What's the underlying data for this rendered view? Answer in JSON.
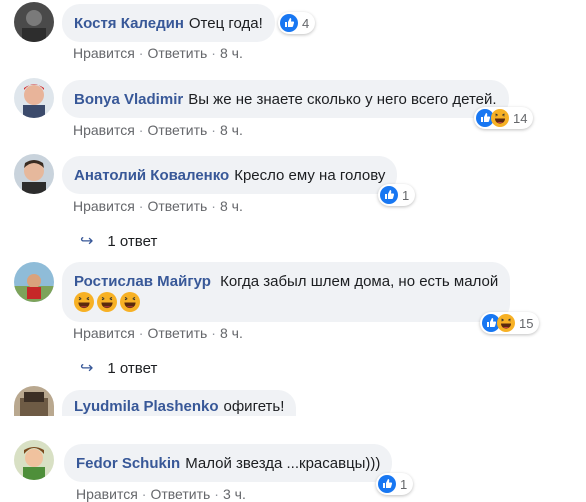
{
  "comments": [
    {
      "author": "Костя Каледин",
      "text": "Отец года!",
      "actions": {
        "like": "Нравится",
        "reply": "Ответить",
        "time": "8 ч."
      },
      "reactions": {
        "types": [
          "like"
        ],
        "count": "4"
      }
    },
    {
      "author": "Bonya Vladimir",
      "text": "Вы же не знаете сколько у него всего детей.",
      "actions": {
        "like": "Нравится",
        "reply": "Ответить",
        "time": "8 ч."
      },
      "reactions": {
        "types": [
          "like",
          "haha"
        ],
        "count": "14"
      }
    },
    {
      "author": "Анатолий Коваленко",
      "text": "Кресло ему на голову",
      "actions": {
        "like": "Нравится",
        "reply": "Ответить",
        "time": "8 ч."
      },
      "reactions": {
        "types": [
          "like"
        ],
        "count": "1"
      },
      "replies": "1 ответ"
    },
    {
      "author": "Ростислав Майгур",
      "text": "Когда забыл шлем дома, но есть малой",
      "emojis": [
        "haha-icon",
        "haha-icon",
        "haha-icon"
      ],
      "actions": {
        "like": "Нравится",
        "reply": "Ответить",
        "time": "8 ч."
      },
      "reactions": {
        "types": [
          "like",
          "haha"
        ],
        "count": "15"
      },
      "replies": "1 ответ"
    },
    {
      "author": "Lyudmila Plashenko",
      "text": "офигеть!"
    },
    {
      "author": "Fedor Schukin",
      "text": "Малой звезда ...красавцы)))",
      "actions": {
        "like": "Нравится",
        "reply": "Ответить",
        "time": "3 ч."
      },
      "reactions": {
        "types": [
          "like"
        ],
        "count": "1"
      }
    }
  ],
  "separator": "·",
  "colors": {
    "link": "#385898",
    "bubble": "#f0f2f5",
    "meta": "#65676b",
    "like": "#1877f2",
    "haha": "#f7b125"
  }
}
